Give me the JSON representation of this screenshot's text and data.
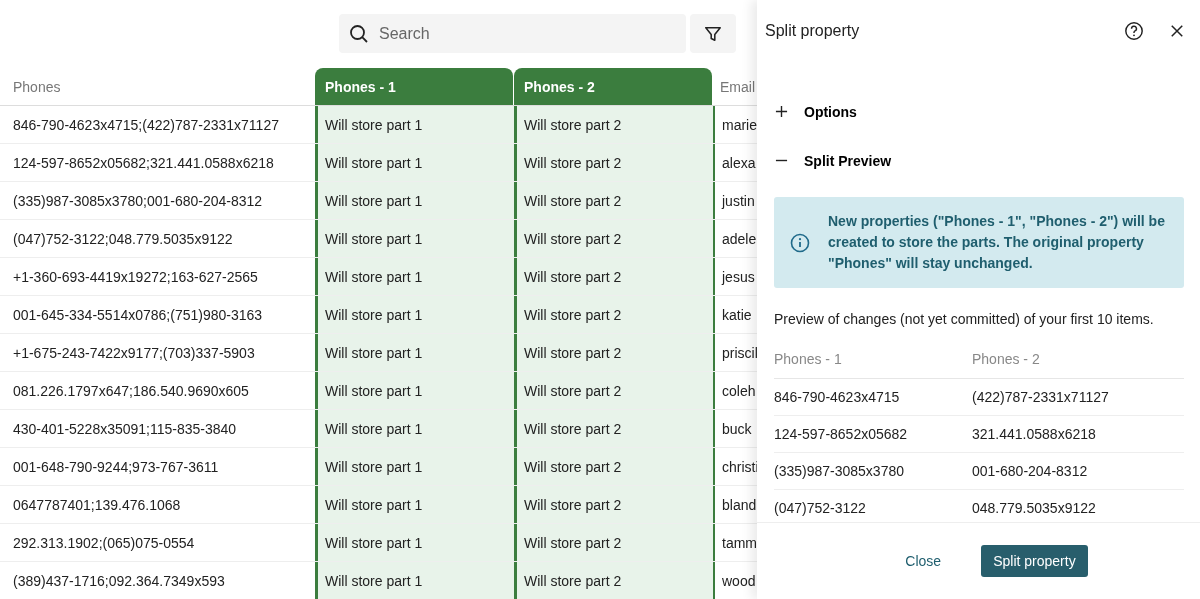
{
  "search": {
    "placeholder": "Search"
  },
  "table": {
    "columns": [
      {
        "label": "Phones",
        "kind": "plain"
      },
      {
        "label": "Phones - 1",
        "kind": "new"
      },
      {
        "label": "Phones - 2",
        "kind": "new"
      },
      {
        "label": "Email",
        "kind": "plain"
      }
    ],
    "rows": [
      [
        "846-790-4623x4715;(422)787-2331x71127",
        "Will store part 1",
        "Will store part 2",
        "marie"
      ],
      [
        "124-597-8652x05682;321.441.0588x6218",
        "Will store part 1",
        "Will store part 2",
        "alexa"
      ],
      [
        "(335)987-3085x3780;001-680-204-8312",
        "Will store part 1",
        "Will store part 2",
        "justin"
      ],
      [
        "(047)752-3122;048.779.5035x9122",
        "Will store part 1",
        "Will store part 2",
        "adele"
      ],
      [
        "+1-360-693-4419x19272;163-627-2565",
        "Will store part 1",
        "Will store part 2",
        "jesus"
      ],
      [
        "001-645-334-5514x0786;(751)980-3163",
        "Will store part 1",
        "Will store part 2",
        "katie"
      ],
      [
        "+1-675-243-7422x9177;(703)337-5903",
        "Will store part 1",
        "Will store part 2",
        "priscil"
      ],
      [
        "081.226.1797x647;186.540.9690x605",
        "Will store part 1",
        "Will store part 2",
        "coleh"
      ],
      [
        "430-401-5228x35091;115-835-3840",
        "Will store part 1",
        "Will store part 2",
        "buck"
      ],
      [
        "001-648-790-9244;973-767-3611",
        "Will store part 1",
        "Will store part 2",
        "christi"
      ],
      [
        "0647787401;139.476.1068",
        "Will store part 1",
        "Will store part 2",
        "bland"
      ],
      [
        "292.313.1902;(065)075-0554",
        "Will store part 1",
        "Will store part 2",
        "tamm"
      ],
      [
        "(389)437-1716;092.364.7349x593",
        "Will store part 1",
        "Will store part 2",
        "wood"
      ]
    ]
  },
  "panel": {
    "title": "Split property",
    "sections": [
      {
        "label": "Options",
        "expanded": false
      },
      {
        "label": "Split Preview",
        "expanded": true
      }
    ],
    "info": "New properties (\"Phones - 1\", \"Phones - 2\") will be created to store the parts. The original property \"Phones\" will stay unchanged.",
    "caption": "Preview of changes (not yet committed) of your first 10 items.",
    "preview_columns": [
      "Phones - 1",
      "Phones - 2"
    ],
    "preview_rows": [
      [
        "846-790-4623x4715",
        "(422)787-2331x71127"
      ],
      [
        "124-597-8652x05682",
        "321.441.0588x6218"
      ],
      [
        "(335)987-3085x3780",
        "001-680-204-8312"
      ],
      [
        "(047)752-3122",
        "048.779.5035x9122"
      ]
    ],
    "buttons": [
      {
        "label": "Close",
        "kind": "text"
      },
      {
        "label": "Split property",
        "kind": "primary"
      }
    ]
  }
}
